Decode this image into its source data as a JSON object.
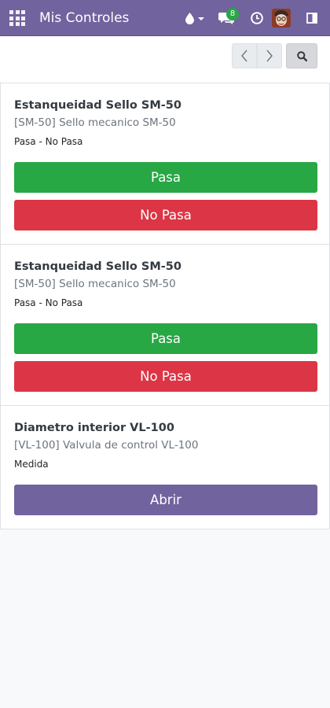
{
  "header": {
    "title": "Mis Controles",
    "icons": [
      "apps-icon",
      "water-drop-icon",
      "chat-icon",
      "clock-icon",
      "avatar",
      "side-panel-icon"
    ],
    "messages_badge": "8",
    "colors": {
      "brand": "#71639e",
      "badge": "#28a745"
    }
  },
  "toolbar": {
    "icons": [
      "chevron-left-icon",
      "chevron-right-icon",
      "search-icon"
    ]
  },
  "checks": [
    {
      "title": "Estanqueidad Sello SM-50",
      "product": "[SM-50] Sello mecanico SM-50",
      "type": "Pasa - No Pasa",
      "pass_label": "Pasa",
      "fail_label": "No Pasa"
    },
    {
      "title": "Estanqueidad Sello SM-50",
      "product": "[SM-50] Sello mecanico SM-50",
      "type": "Pasa - No Pasa",
      "pass_label": "Pasa",
      "fail_label": "No Pasa"
    },
    {
      "title": "Diametro interior VL-100",
      "product": "[VL-100] Valvula de control VL-100",
      "type": "Medida",
      "open_label": "Abrir"
    }
  ],
  "colors": {
    "pass": "#28a745",
    "fail": "#dc3545",
    "open": "#71639e"
  }
}
